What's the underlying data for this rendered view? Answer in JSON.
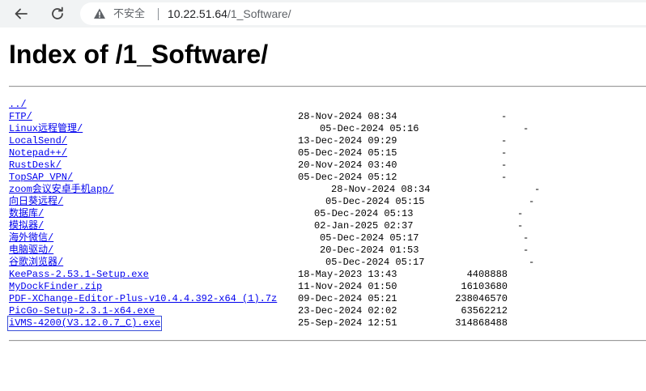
{
  "browser": {
    "security_text": "不安全",
    "url_host": "10.22.51.64",
    "url_path": "/1_Software/"
  },
  "page": {
    "title": "Index of /1_Software/"
  },
  "entries": [
    {
      "name": "../",
      "date": "",
      "size": ""
    },
    {
      "name": "FTP/",
      "date": "28-Nov-2024 08:34",
      "size": "-"
    },
    {
      "name": "Linux远程管理/",
      "date": "05-Dec-2024 05:16",
      "size": "-"
    },
    {
      "name": "LocalSend/",
      "date": "13-Dec-2024 09:29",
      "size": "-"
    },
    {
      "name": "Notepad++/",
      "date": "05-Dec-2024 05:15",
      "size": "-"
    },
    {
      "name": "RustDesk/",
      "date": "20-Nov-2024 03:40",
      "size": "-"
    },
    {
      "name": "TopSAP VPN/",
      "date": "05-Dec-2024 05:12",
      "size": "-"
    },
    {
      "name": "zoom会议安卓手机app/",
      "date": "28-Nov-2024 08:34",
      "size": "-"
    },
    {
      "name": "向日葵远程/",
      "date": "05-Dec-2024 05:15",
      "size": "-"
    },
    {
      "name": "数据库/",
      "date": "05-Dec-2024 05:13",
      "size": "-"
    },
    {
      "name": "模拟器/",
      "date": "02-Jan-2025 02:37",
      "size": "-"
    },
    {
      "name": "海外微信/",
      "date": "05-Dec-2024 05:17",
      "size": "-"
    },
    {
      "name": "电脑驱动/",
      "date": "20-Dec-2024 01:53",
      "size": "-"
    },
    {
      "name": "谷歌浏览器/",
      "date": "05-Dec-2024 05:17",
      "size": "-"
    },
    {
      "name": "KeePass-2.53.1-Setup.exe",
      "date": "18-May-2023 13:43",
      "size": "4408888"
    },
    {
      "name": "MyDockFinder.zip",
      "date": "11-Nov-2024 01:50",
      "size": "16103680"
    },
    {
      "name": "PDF-XChange-Editor-Plus-v10.4.4.392-x64 (1).7z",
      "date": "09-Dec-2024 05:21",
      "size": "238046570"
    },
    {
      "name": "PicGo-Setup-2.3.1-x64.exe",
      "date": "23-Dec-2024 02:02",
      "size": "63562212"
    },
    {
      "name": "iVMS-4200(V3.12.0.7_C).exe",
      "date": "25-Sep-2024 12:51",
      "size": "314868488"
    }
  ]
}
